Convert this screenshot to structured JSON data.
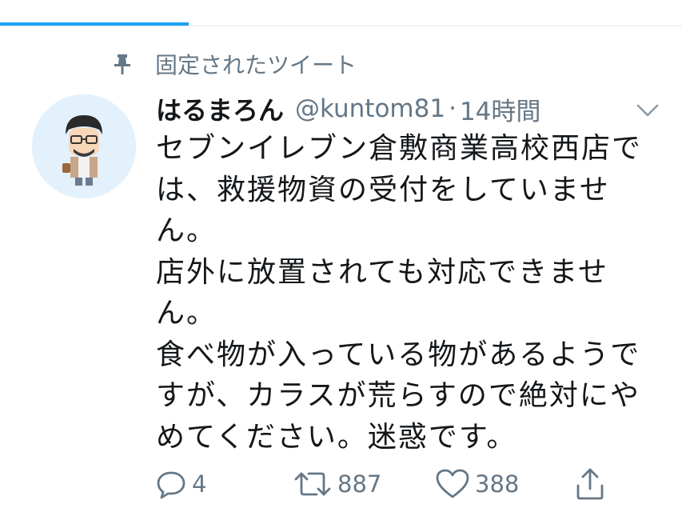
{
  "pinned": {
    "label": "固定されたツイート",
    "icon": "pin-icon"
  },
  "author": {
    "display_name": "はるまろん",
    "handle": "@kuntom81",
    "separator": "·",
    "time": "14時間",
    "avatar_caption": "harumaron"
  },
  "tweet": {
    "text": "セブンイレブン倉敷商業高校西店で\nは、救援物資の受付をしていませ\nん。\n店外に放置されても対応できませ\nん。\n食べ物が入っている物があるようで\nすが、カラスが荒らすので絶対にや\nめてください。迷惑です。"
  },
  "actions": {
    "reply": {
      "icon": "reply-icon",
      "count": "4"
    },
    "retweet": {
      "icon": "retweet-icon",
      "count": "887"
    },
    "like": {
      "icon": "heart-icon",
      "count": "388"
    },
    "share": {
      "icon": "share-icon"
    }
  },
  "colors": {
    "accent": "#1da1f2",
    "secondary_text": "#657786",
    "primary_text": "#14171a"
  }
}
